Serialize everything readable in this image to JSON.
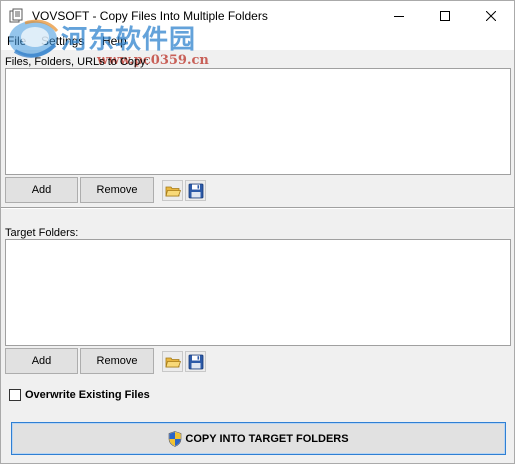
{
  "window": {
    "title": "VOVSOFT - Copy Files Into Multiple Folders",
    "minimize_icon": "minimize-icon",
    "maximize_icon": "maximize-icon",
    "close_icon": "close-icon"
  },
  "menu": {
    "items": [
      "File",
      "Settings",
      "Help"
    ]
  },
  "watermark": {
    "site_name": "河东软件园",
    "site_url": "www.pc0359.cn"
  },
  "source_section": {
    "label": "Files, Folders, URLs to Copy:",
    "items": [],
    "add_label": "Add",
    "remove_label": "Remove",
    "open_icon": "folder-open-icon",
    "save_icon": "floppy-save-icon"
  },
  "target_section": {
    "label": "Target Folders:",
    "items": [],
    "add_label": "Add",
    "remove_label": "Remove",
    "open_icon": "folder-open-icon",
    "save_icon": "floppy-save-icon"
  },
  "options": {
    "overwrite_label": "Overwrite Existing Files",
    "overwrite_checked": false
  },
  "action": {
    "copy_label": "COPY INTO TARGET FOLDERS",
    "copy_icon": "uac-shield-icon"
  },
  "colors": {
    "accent_border": "#2f7fd3",
    "button_face": "#e1e1e1",
    "window_bg": "#f0f0f0"
  }
}
